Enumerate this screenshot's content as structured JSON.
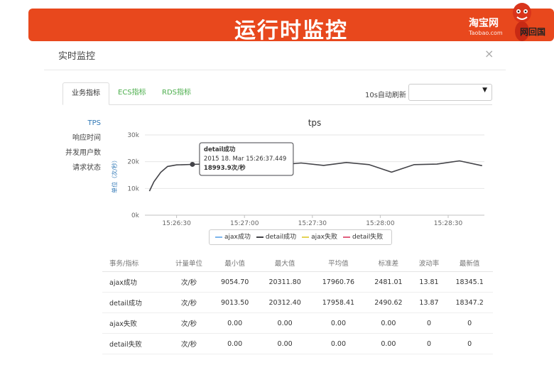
{
  "banner": {
    "title": "运行时监控",
    "logo_text": "淘宝网",
    "logo_sub": "Taobao.com",
    "corner_text": "网回国",
    "color": "#e8481d"
  },
  "dialog": {
    "title": "实时监控",
    "close_icon": "×"
  },
  "tabs": [
    {
      "label": "业务指标",
      "active": true
    },
    {
      "label": "ECS指标",
      "active": false
    },
    {
      "label": "RDS指标",
      "active": false
    }
  ],
  "refresh": {
    "label": "10s自动刷新",
    "value": ""
  },
  "sidenav": [
    {
      "label": "TPS",
      "active": true
    },
    {
      "label": "响应时间",
      "active": false
    },
    {
      "label": "并发用户数",
      "active": false
    },
    {
      "label": "请求状态",
      "active": false
    }
  ],
  "tooltip": {
    "series": "detail成功",
    "time": "2015 18. Mar 15:26:37.449",
    "value": "18993.9次/秒"
  },
  "chart_data": {
    "type": "line",
    "title": "tps",
    "ylabel": "单位（次/秒）",
    "ylim": [
      0,
      30000
    ],
    "yticks": [
      "0k",
      "10k",
      "20k",
      "30k"
    ],
    "xticks": [
      "15:26:30",
      "15:27:00",
      "15:27:30",
      "15:28:00",
      "15:28:30"
    ],
    "series": [
      {
        "name": "detail成功",
        "color": "#434348",
        "points": [
          [
            "15:26:18",
            9000
          ],
          [
            "15:26:20",
            12500
          ],
          [
            "15:26:23",
            16000
          ],
          [
            "15:26:26",
            18200
          ],
          [
            "15:26:30",
            18800
          ],
          [
            "15:26:37",
            18993.9
          ],
          [
            "15:26:45",
            19200
          ],
          [
            "15:26:55",
            18300
          ],
          [
            "15:27:05",
            18000
          ],
          [
            "15:27:15",
            18800
          ],
          [
            "15:27:25",
            19500
          ],
          [
            "15:27:35",
            18600
          ],
          [
            "15:27:45",
            19700
          ],
          [
            "15:27:55",
            18900
          ],
          [
            "15:28:05",
            16100
          ],
          [
            "15:28:15",
            18900
          ],
          [
            "15:28:25",
            19100
          ],
          [
            "15:28:35",
            20300
          ],
          [
            "15:28:45",
            18500
          ]
        ]
      }
    ],
    "legend": [
      {
        "name": "ajax成功",
        "color": "#7cb5ec"
      },
      {
        "name": "detail成功",
        "color": "#434348"
      },
      {
        "name": "ajax失败",
        "color": "#e4d354"
      },
      {
        "name": "detail失败",
        "color": "#e0607e"
      }
    ]
  },
  "table": {
    "headers": [
      "事务/指标",
      "计量单位",
      "最小值",
      "最大值",
      "平均值",
      "标准差",
      "波动率",
      "最新值"
    ],
    "rows": [
      [
        "ajax成功",
        "次/秒",
        "9054.70",
        "20311.80",
        "17960.76",
        "2481.01",
        "13.81",
        "18345.1"
      ],
      [
        "detail成功",
        "次/秒",
        "9013.50",
        "20312.40",
        "17958.41",
        "2490.62",
        "13.87",
        "18347.2"
      ],
      [
        "ajax失败",
        "次/秒",
        "0.00",
        "0.00",
        "0.00",
        "0.00",
        "0",
        "0"
      ],
      [
        "detail失败",
        "次/秒",
        "0.00",
        "0.00",
        "0.00",
        "0.00",
        "0",
        "0"
      ]
    ]
  }
}
